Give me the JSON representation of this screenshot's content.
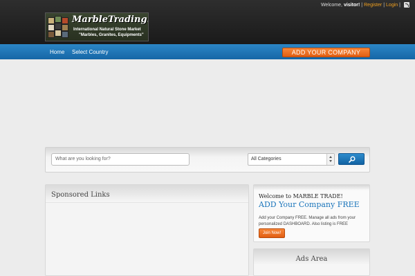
{
  "header": {
    "welcome_prefix": "Welcome,",
    "visitor": "visitor!",
    "register": "Register",
    "login": "Login",
    "rss_icon": "rss-icon"
  },
  "logo": {
    "title": "MarbleTrading.net",
    "line1": "International Natural Stone Market",
    "line2": "\"Marbles, Granites, Equipments\""
  },
  "nav": {
    "items": [
      "Home",
      "Select Country"
    ],
    "add_company": "ADD YOUR COMPANY"
  },
  "search": {
    "placeholder": "What are you looking for?",
    "category": "All Categories",
    "button_icon": "search-icon"
  },
  "sponsored": {
    "title": "Sponsored Links"
  },
  "welcome_box": {
    "title": "Welcome to MARBLE TRADE!",
    "headline": "ADD Your Company FREE",
    "text": "Add your Company FREE. Manage all ads from your personalized DASHBOARD. Also listing is FREE",
    "button": "Join Now!"
  },
  "ads": {
    "title": "Ads Area"
  },
  "colors": {
    "accent_orange": "#e8671c",
    "nav_blue": "#1b75bb",
    "link_orange": "#f0a020"
  }
}
